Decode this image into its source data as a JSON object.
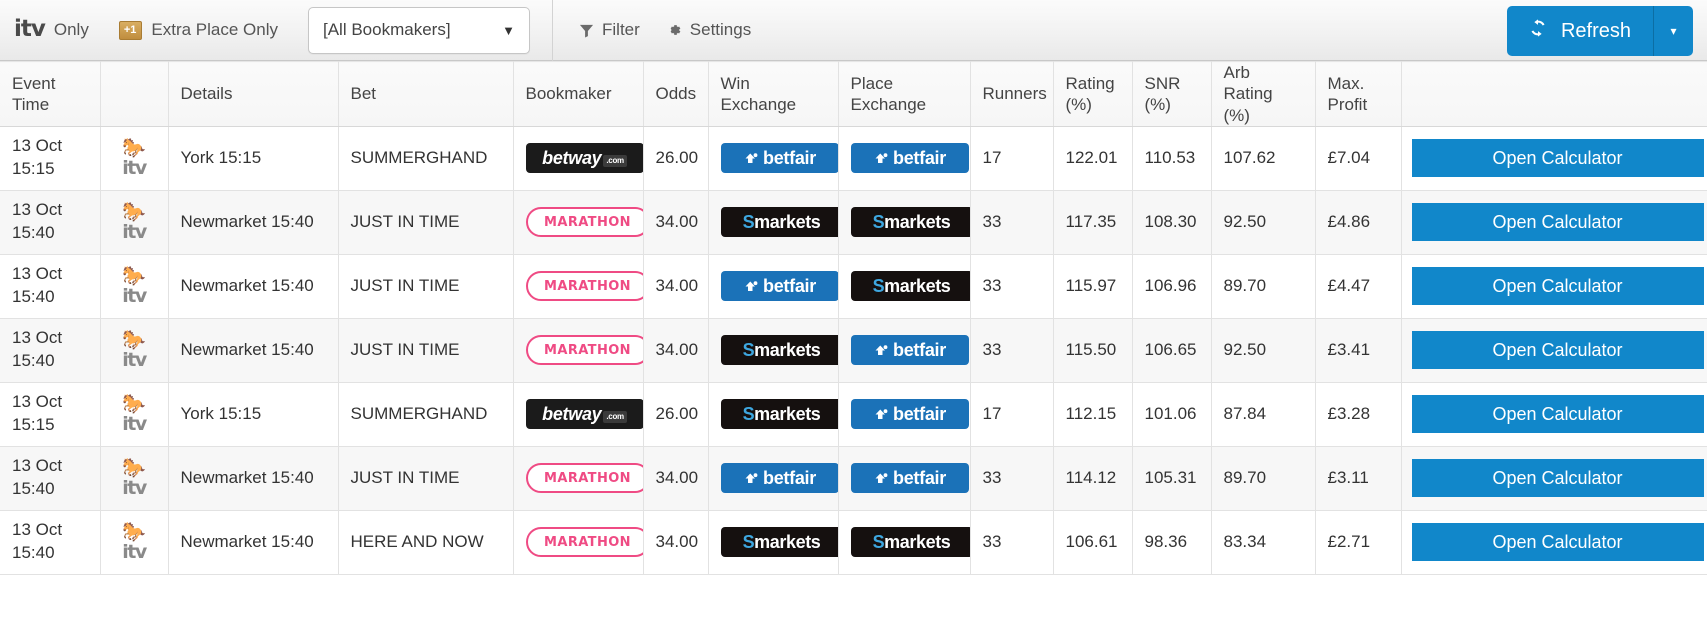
{
  "toolbar": {
    "itv_logo_text": "itv",
    "itv_only_label": "Only",
    "extra_place_badge": "+1",
    "extra_place_label": "Extra Place Only",
    "bookmaker_select_value": "[All Bookmakers]",
    "select_caret": "▼",
    "filter_label": "Filter",
    "settings_label": "Settings",
    "refresh_label": "Refresh",
    "refresh_caret": "▾",
    "accent_color": "#1187ca"
  },
  "table": {
    "columns": [
      "Event Time",
      "",
      "Details",
      "Bet",
      "Bookmaker",
      "Odds",
      "Win Exchange",
      "Place Exchange",
      "Runners",
      "Rating (%)",
      "SNR (%)",
      "Arb Rating (%)",
      "Max. Profit",
      ""
    ],
    "column_lines": {
      "event_time": [
        "Event",
        "Time"
      ],
      "rating": [
        "Rating",
        "(%)"
      ],
      "snr": [
        "SNR",
        "(%)"
      ],
      "arb": [
        "Arb Rating",
        "(%)"
      ],
      "profit": [
        "Max.",
        "Profit"
      ],
      "place_exchange": [
        "Place",
        "Exchange"
      ]
    },
    "calculator_label": "Open Calculator",
    "rows": [
      {
        "date": "13 Oct",
        "time": "15:15",
        "channel": "itv",
        "sport_icon": "horse-racing-icon",
        "details": "York 15:15",
        "bet": "SUMMERGHAND",
        "bookmaker": "betway",
        "odds": "26.00",
        "win_exchange": "betfair",
        "place_exchange": "betfair",
        "runners": "17",
        "rating": "122.01",
        "snr": "110.53",
        "arb_rating": "107.62",
        "max_profit": "£7.04"
      },
      {
        "date": "13 Oct",
        "time": "15:40",
        "channel": "itv",
        "sport_icon": "horse-racing-icon",
        "details": "Newmarket 15:40",
        "bet": "JUST IN TIME",
        "bookmaker": "marathon",
        "odds": "34.00",
        "win_exchange": "smarkets",
        "place_exchange": "smarkets",
        "runners": "33",
        "rating": "117.35",
        "snr": "108.30",
        "arb_rating": "92.50",
        "max_profit": "£4.86"
      },
      {
        "date": "13 Oct",
        "time": "15:40",
        "channel": "itv",
        "sport_icon": "horse-racing-icon",
        "details": "Newmarket 15:40",
        "bet": "JUST IN TIME",
        "bookmaker": "marathon",
        "odds": "34.00",
        "win_exchange": "betfair",
        "place_exchange": "smarkets",
        "runners": "33",
        "rating": "115.97",
        "snr": "106.96",
        "arb_rating": "89.70",
        "max_profit": "£4.47"
      },
      {
        "date": "13 Oct",
        "time": "15:40",
        "channel": "itv",
        "sport_icon": "horse-racing-icon",
        "details": "Newmarket 15:40",
        "bet": "JUST IN TIME",
        "bookmaker": "marathon",
        "odds": "34.00",
        "win_exchange": "smarkets",
        "place_exchange": "betfair",
        "runners": "33",
        "rating": "115.50",
        "snr": "106.65",
        "arb_rating": "92.50",
        "max_profit": "£3.41"
      },
      {
        "date": "13 Oct",
        "time": "15:15",
        "channel": "itv",
        "sport_icon": "horse-racing-icon",
        "details": "York 15:15",
        "bet": "SUMMERGHAND",
        "bookmaker": "betway",
        "odds": "26.00",
        "win_exchange": "smarkets",
        "place_exchange": "betfair",
        "runners": "17",
        "rating": "112.15",
        "snr": "101.06",
        "arb_rating": "87.84",
        "max_profit": "£3.28"
      },
      {
        "date": "13 Oct",
        "time": "15:40",
        "channel": "itv",
        "sport_icon": "horse-racing-icon",
        "details": "Newmarket 15:40",
        "bet": "JUST IN TIME",
        "bookmaker": "marathon",
        "odds": "34.00",
        "win_exchange": "betfair",
        "place_exchange": "betfair",
        "runners": "33",
        "rating": "114.12",
        "snr": "105.31",
        "arb_rating": "89.70",
        "max_profit": "£3.11"
      },
      {
        "date": "13 Oct",
        "time": "15:40",
        "channel": "itv",
        "sport_icon": "horse-racing-icon",
        "details": "Newmarket 15:40",
        "bet": "HERE AND NOW",
        "bookmaker": "marathon",
        "odds": "34.00",
        "win_exchange": "smarkets",
        "place_exchange": "smarkets",
        "runners": "33",
        "rating": "106.61",
        "snr": "98.36",
        "arb_rating": "83.34",
        "max_profit": "£2.71"
      }
    ]
  },
  "logos": {
    "betway": {
      "text": "betway",
      "suffix": ".com",
      "bg": "#1b1b1b",
      "fg": "#ffffff"
    },
    "marathon": {
      "text": "MARATHON",
      "bg": "#ffffff",
      "fg": "#ef4b84"
    },
    "betfair": {
      "text": "betfair",
      "bg": "#1b72b8",
      "fg": "#ffffff"
    },
    "smarkets": {
      "text": "markets",
      "lead": "S",
      "bg": "#15100f",
      "fg": "#ffffff"
    }
  }
}
